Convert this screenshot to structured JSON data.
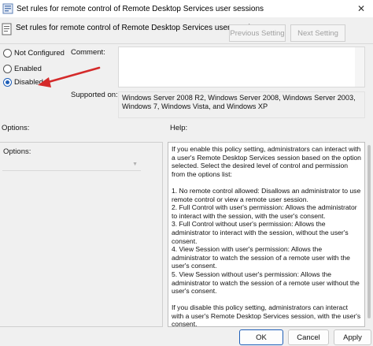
{
  "window": {
    "title": "Set rules for remote control of Remote Desktop Services user sessions",
    "close_glyph": "✕"
  },
  "header": {
    "policy_name": "Set rules for remote control of Remote Desktop Services user sessions",
    "previous_label": "Previous Setting",
    "next_label": "Next Setting"
  },
  "state": {
    "options": [
      {
        "label": "Not Configured",
        "selected": false
      },
      {
        "label": "Enabled",
        "selected": false
      },
      {
        "label": "Disabled",
        "selected": true
      }
    ]
  },
  "annotation": {
    "color": "#d42a2a",
    "icon": "red-arrow"
  },
  "comment": {
    "label": "Comment:",
    "value": ""
  },
  "supported": {
    "label": "Supported on:",
    "value": "Windows Server 2008 R2, Windows Server 2008, Windows Server 2003, Windows 7, Windows Vista, and Windows XP"
  },
  "options_section": {
    "label": "Options:",
    "pane_title": "Options:",
    "dropdown_value": ""
  },
  "help_section": {
    "label": "Help:",
    "paragraphs": [
      "If you enable this policy setting, administrators can interact with a user's Remote Desktop Services session based on the option selected. Select the desired level of control and permission from the options list:",
      "1. No remote control allowed: Disallows an administrator to use remote control or view a remote user session.",
      "2. Full Control with user's permission: Allows the administrator to interact with the session, with the user's consent.",
      "3. Full Control without user's permission: Allows the administrator to interact with the session, without the user's consent.",
      "4. View Session with user's permission: Allows the administrator to watch the session of a remote user with the user's consent.",
      "5. View Session without user's permission: Allows the administrator to watch the session of a remote user without the user's consent.",
      "If you disable this policy setting, administrators can interact with a user's Remote Desktop Services session, with the user's consent."
    ]
  },
  "buttons": {
    "ok": "OK",
    "cancel": "Cancel",
    "apply": "Apply"
  },
  "colors": {
    "accent": "#1f5fb8",
    "window_bg": "#f0f0f0"
  }
}
